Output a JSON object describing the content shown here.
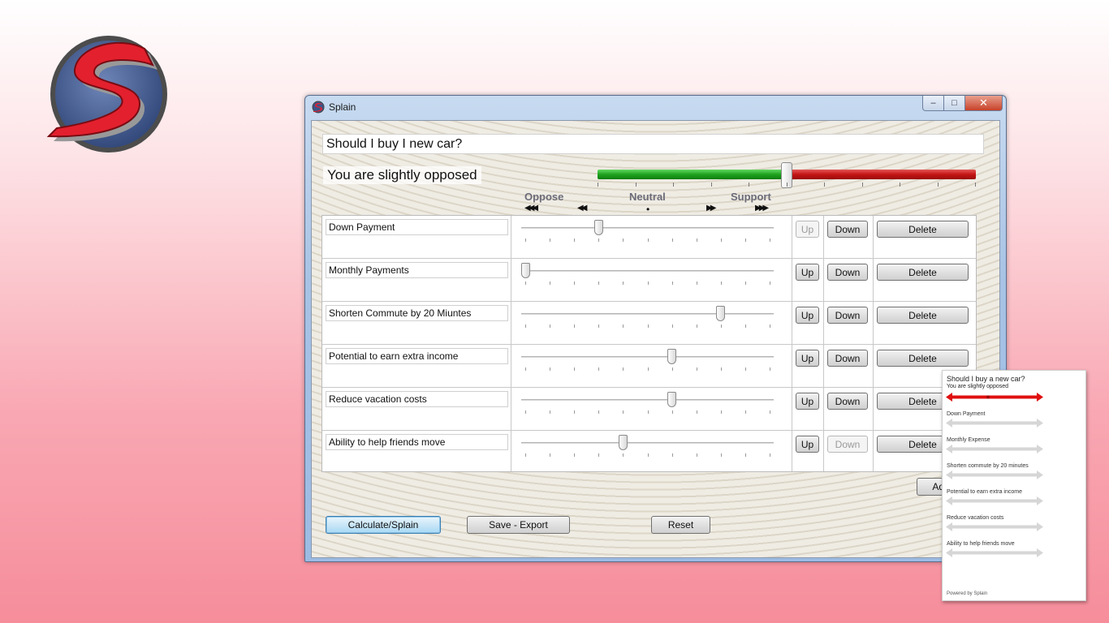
{
  "window": {
    "title": "Splain",
    "caption": {
      "minimize": "–",
      "maximize": "□",
      "close": "✕"
    }
  },
  "question": "Should I buy I new car?",
  "verdict": "You are slightly opposed",
  "overall_score": 0.5,
  "scale": {
    "oppose_label": "Oppose",
    "neutral_label": "Neutral",
    "support_label": "Support",
    "strong_oppose_arrows": "◀◀◀",
    "oppose_arrows": "◀◀",
    "neutral_dot": "•",
    "support_arrows": "▶▶",
    "strong_support_arrows": "▶▶▶"
  },
  "factors": [
    {
      "label": "Down Payment",
      "value": 0.3,
      "up": "Up",
      "down": "Down",
      "delete": "Delete",
      "up_enabled": false,
      "down_enabled": true
    },
    {
      "label": "Monthly Payments",
      "value": 0.0,
      "up": "Up",
      "down": "Down",
      "delete": "Delete",
      "up_enabled": true,
      "down_enabled": true
    },
    {
      "label": "Shorten Commute by 20 Miuntes",
      "value": 0.8,
      "up": "Up",
      "down": "Down",
      "delete": "Delete",
      "up_enabled": true,
      "down_enabled": true
    },
    {
      "label": "Potential to earn extra income",
      "value": 0.6,
      "up": "Up",
      "down": "Down",
      "delete": "Delete",
      "up_enabled": true,
      "down_enabled": true
    },
    {
      "label": "Reduce vacation costs",
      "value": 0.6,
      "up": "Up",
      "down": "Down",
      "delete": "Delete",
      "up_enabled": true,
      "down_enabled": true
    },
    {
      "label": "Ability to help friends move",
      "value": 0.4,
      "up": "Up",
      "down": "Down",
      "delete": "Delete",
      "up_enabled": true,
      "down_enabled": false
    }
  ],
  "buttons": {
    "add": "Add",
    "calculate": "Calculate/Splain",
    "save_export": "Save - Export",
    "reset": "Reset"
  },
  "preview": {
    "title": "Should I buy a new car?",
    "verdict": "You are slightly opposed",
    "items": [
      "Down Payment",
      "Monthly Expense",
      "Shorten commute by 20 minutes",
      "Potential to earn extra income",
      "Reduce vacation costs",
      "Ability to help friends move"
    ],
    "footer": "Powered by Splain"
  },
  "colors": {
    "support_green": "#1fa31f",
    "oppose_red": "#c41515",
    "preview_red": "#e01010",
    "preview_gray": "#d6d6d6"
  }
}
